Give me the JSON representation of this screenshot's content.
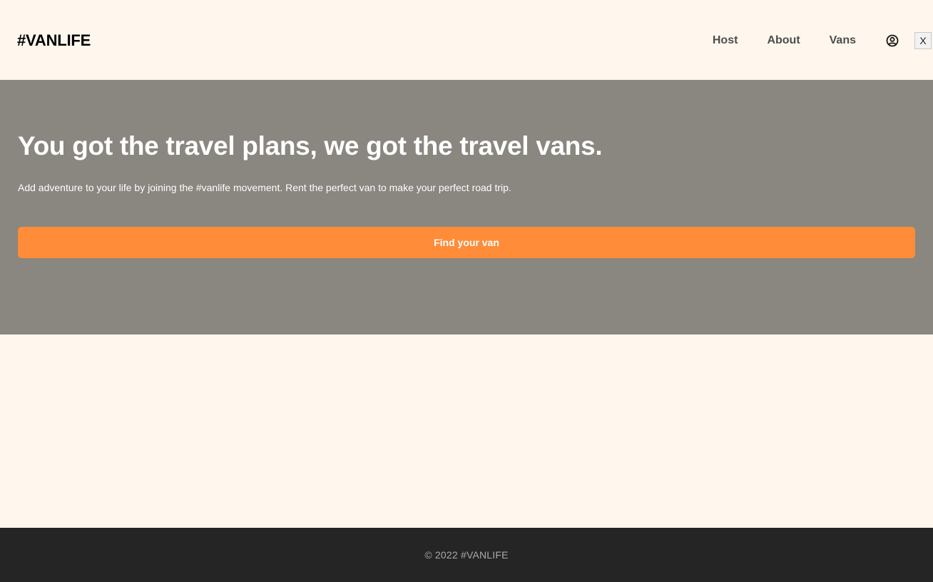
{
  "header": {
    "logo": "#VANLIFE",
    "nav": {
      "host": "Host",
      "about": "About",
      "vans": "Vans"
    },
    "user_icon": "user-circle-icon",
    "close_label": "X"
  },
  "hero": {
    "title": "You got the travel plans, we got the travel vans.",
    "subtitle": "Add adventure to your life by joining the #vanlife movement. Rent the perfect van to make your perfect road trip.",
    "cta_label": "Find your van"
  },
  "footer": {
    "text": "© 2022 #VANLIFE"
  },
  "colors": {
    "page_background": "#FFF7ED",
    "hero_background": "#8A8680",
    "accent": "#FF8C38",
    "footer_background": "#252525"
  }
}
